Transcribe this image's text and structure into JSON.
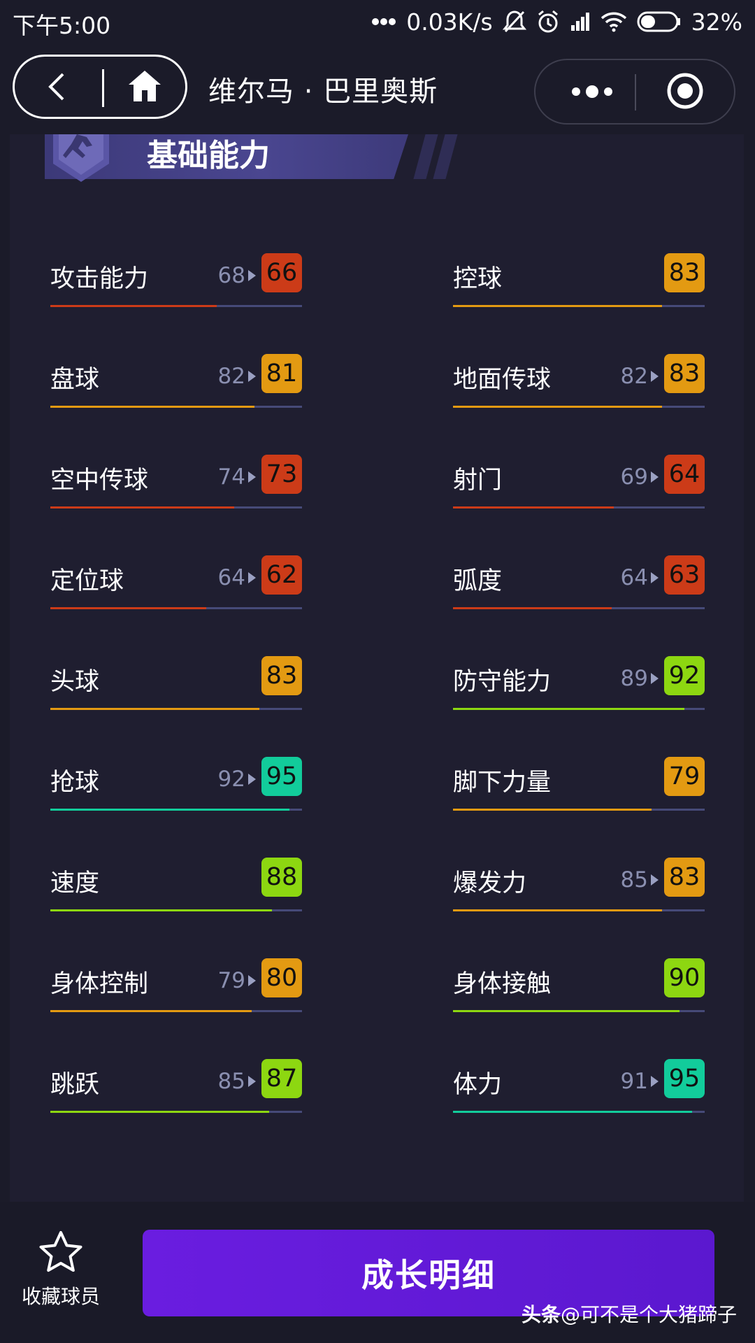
{
  "status_bar": {
    "time": "下午5:00",
    "net_speed": "0.03K/s",
    "battery": "32%"
  },
  "nav": {
    "title": "维尔马 · 巴里奥斯"
  },
  "section": {
    "title": "基础能力"
  },
  "colors": {
    "red": "#cc3b18",
    "orange": "#e39a12",
    "lime": "#8dd711",
    "teal": "#12cc9b"
  },
  "stats_left": [
    {
      "label": "攻击能力",
      "prev": "68",
      "value": "66",
      "color": "red",
      "fill": 0.66
    },
    {
      "label": "盘球",
      "prev": "82",
      "value": "81",
      "color": "orange",
      "fill": 0.81
    },
    {
      "label": "空中传球",
      "prev": "74",
      "value": "73",
      "color": "red",
      "fill": 0.73
    },
    {
      "label": "定位球",
      "prev": "64",
      "value": "62",
      "color": "red",
      "fill": 0.62
    },
    {
      "label": "头球",
      "prev": "",
      "value": "83",
      "color": "orange",
      "fill": 0.83
    },
    {
      "label": "抢球",
      "prev": "92",
      "value": "95",
      "color": "teal",
      "fill": 0.95
    },
    {
      "label": "速度",
      "prev": "",
      "value": "88",
      "color": "lime",
      "fill": 0.88
    },
    {
      "label": "身体控制",
      "prev": "79",
      "value": "80",
      "color": "orange",
      "fill": 0.8
    },
    {
      "label": "跳跃",
      "prev": "85",
      "value": "87",
      "color": "lime",
      "fill": 0.87
    }
  ],
  "stats_right": [
    {
      "label": "控球",
      "prev": "",
      "value": "83",
      "color": "orange",
      "fill": 0.83
    },
    {
      "label": "地面传球",
      "prev": "82",
      "value": "83",
      "color": "orange",
      "fill": 0.83
    },
    {
      "label": "射门",
      "prev": "69",
      "value": "64",
      "color": "red",
      "fill": 0.64
    },
    {
      "label": "弧度",
      "prev": "64",
      "value": "63",
      "color": "red",
      "fill": 0.63
    },
    {
      "label": "防守能力",
      "prev": "89",
      "value": "92",
      "color": "lime",
      "fill": 0.92
    },
    {
      "label": "脚下力量",
      "prev": "",
      "value": "79",
      "color": "orange",
      "fill": 0.79
    },
    {
      "label": "爆发力",
      "prev": "85",
      "value": "83",
      "color": "orange",
      "fill": 0.83
    },
    {
      "label": "身体接触",
      "prev": "",
      "value": "90",
      "color": "lime",
      "fill": 0.9
    },
    {
      "label": "体力",
      "prev": "91",
      "value": "95",
      "color": "teal",
      "fill": 0.95
    }
  ],
  "bottom": {
    "favorite_label": "收藏球员",
    "growth_label": "成长明细"
  },
  "watermark": {
    "brand": "头条",
    "author": "@可不是个大猪蹄子"
  }
}
